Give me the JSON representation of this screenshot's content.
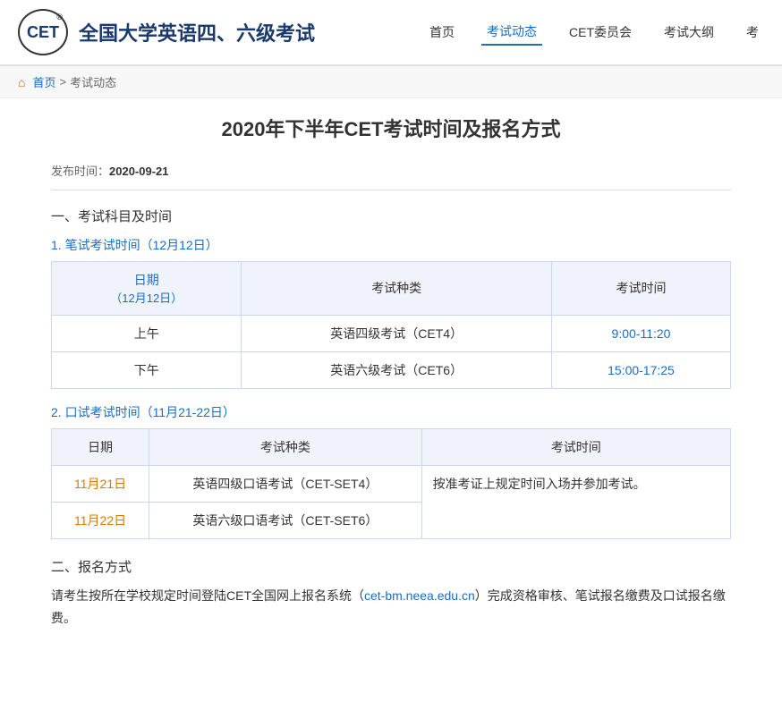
{
  "header": {
    "logo_text": "CET",
    "logo_reg": "®",
    "site_title": "全国大学英语四、六级考试",
    "nav": [
      {
        "label": "首页",
        "active": false
      },
      {
        "label": "考试动态",
        "active": true
      },
      {
        "label": "CET委员会",
        "active": false
      },
      {
        "label": "考试大纲",
        "active": false
      },
      {
        "label": "考",
        "active": false
      }
    ]
  },
  "breadcrumb": {
    "home": "首页",
    "separator": ">",
    "current": "考试动态"
  },
  "article": {
    "title": "2020年下半年CET考试时间及报名方式",
    "publish_label": "发布时间：",
    "publish_date": "2020-09-21",
    "section1_title": "一、考试科目及时间",
    "written_exam_title": "1. 笔试考试时间（12月12日）",
    "written_table": {
      "headers": [
        "日期",
        "考试种类",
        "考试时间"
      ],
      "header_sub": [
        "（12月12日）",
        "",
        ""
      ],
      "rows": [
        {
          "date": "上午",
          "type": "英语四级考试（CET4）",
          "time": "9:00-11:20"
        },
        {
          "date": "下午",
          "type": "英语六级考试（CET6）",
          "time": "15:00-17:25"
        }
      ]
    },
    "oral_exam_title": "2. 口试考试时间（11月21-22日）",
    "oral_table": {
      "headers": [
        "日期",
        "考试种类",
        "考试时间"
      ],
      "rows": [
        {
          "date": "11月21日",
          "type": "英语四级口语考试（CET-SET4）",
          "time_note": "按准考证上规定时间入场并参加考试。"
        },
        {
          "date": "11月22日",
          "type": "英语六级口语考试（CET-SET6）",
          "time_note": ""
        }
      ]
    },
    "section2_title": "二、报名方式",
    "section2_content_prefix": "请考生按所在学校规定时间登陆CET全国网上报名系统（",
    "section2_link_text": "cet-bm.neea.edu.cn",
    "section2_content_suffix": "）完成资格审核、笔试报名缴费及口试报名缴费。"
  }
}
